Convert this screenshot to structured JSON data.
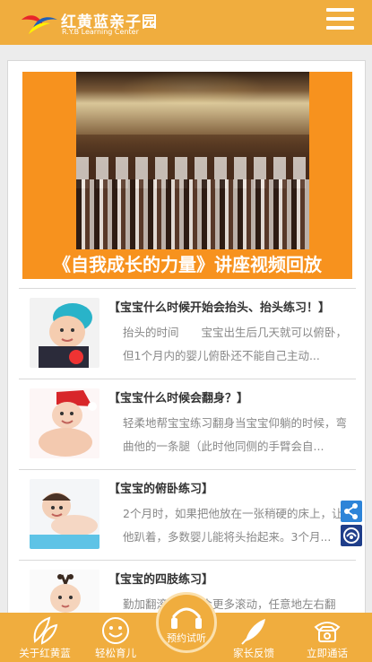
{
  "header": {
    "logo_cn": "红黄蓝亲子园",
    "logo_en": "R.Y.B Learning Center",
    "menu_icon": "hamburger-menu-icon"
  },
  "banner": {
    "title": "《自我成长的力量》讲座视频回放"
  },
  "articles": [
    {
      "title": "【宝宝什么时候开始会抬头、抬头练习！】",
      "desc": "抬头的时间　　宝宝出生后几天就可以俯卧，但1个月内的婴儿俯卧还不能自己主动..."
    },
    {
      "title": "【宝宝什么时候会翻身？】",
      "desc": "轻柔地帮宝宝练习翻身当宝宝仰躺的时候，弯曲他的一条腿（此时他同侧的手臂会自..."
    },
    {
      "title": "【宝宝的俯卧练习】",
      "desc": "2个月时，如果把他放在一张稍硬的床上，让他趴着，多数婴儿能将头抬起来。3个月..."
    },
    {
      "title": "【宝宝的四肢练习】",
      "desc": "勤加翻滚，宝宝会更多滚动，任意地左右翻"
    }
  ],
  "side_actions": {
    "share_icon": "share-icon",
    "service_icon": "customer-service-icon"
  },
  "footer": {
    "items": [
      {
        "label": "关于红黄蓝",
        "icon": "leaf-hand-icon"
      },
      {
        "label": "轻松育儿",
        "icon": "smiley-face-icon"
      },
      {
        "label": "预约试听",
        "icon": "headphones-icon"
      },
      {
        "label": "家长反馈",
        "icon": "feather-icon"
      },
      {
        "label": "立即通话",
        "icon": "telephone-icon"
      }
    ]
  },
  "colors": {
    "brand_orange": "#f0ad3e",
    "banner_orange": "#f7921e",
    "share_blue": "#2d84d8",
    "service_navy": "#1f3e8a"
  }
}
